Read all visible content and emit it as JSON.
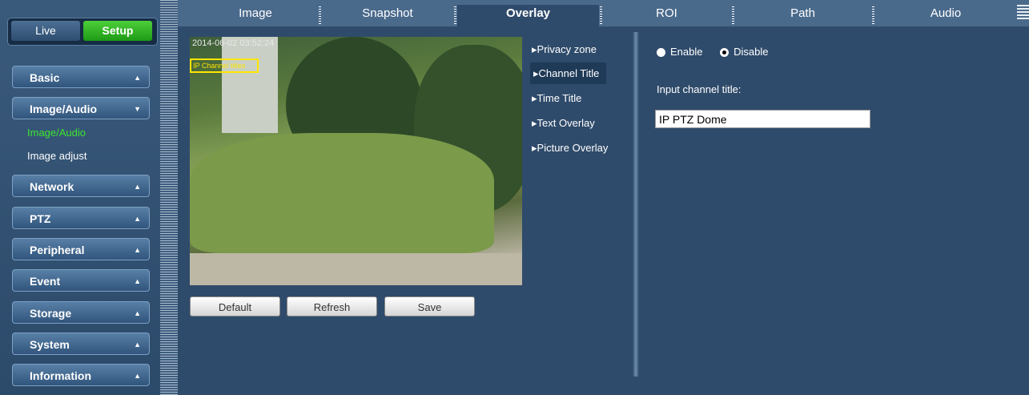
{
  "sidebar": {
    "live_label": "Live",
    "setup_label": "Setup",
    "nav": [
      {
        "label": "Basic",
        "arrow": "▲"
      },
      {
        "label": "Image/Audio",
        "arrow": "▼"
      },
      {
        "label": "Network",
        "arrow": "▲"
      },
      {
        "label": "PTZ",
        "arrow": "▲"
      },
      {
        "label": "Peripheral",
        "arrow": "▲"
      },
      {
        "label": "Event",
        "arrow": "▲"
      },
      {
        "label": "Storage",
        "arrow": "▲"
      },
      {
        "label": "System",
        "arrow": "▲"
      },
      {
        "label": "Information",
        "arrow": "▲"
      }
    ],
    "sub_items": [
      {
        "label": "Image/Audio",
        "color": "#3ee62e"
      },
      {
        "label": "Image adjust",
        "color": "#ffffff"
      }
    ]
  },
  "tabs": [
    "Image",
    "Snapshot",
    "Overlay",
    "ROI",
    "Path",
    "Audio"
  ],
  "active_tab": "Overlay",
  "preview": {
    "timestamp": "2014-06-02 03:52:24",
    "title_overlay": "IP Channel titles"
  },
  "buttons": {
    "default_label": "Default",
    "refresh_label": "Refresh",
    "save_label": "Save"
  },
  "submenu": [
    "▸Privacy zone",
    "▸Channel Title",
    "▸Time Title",
    "▸Text Overlay",
    "▸Picture Overlay"
  ],
  "active_submenu": "▸Channel Title",
  "settings": {
    "enable_label": "Enable",
    "disable_label": "Disable",
    "selected": "Disable",
    "input_label": "Input channel title:",
    "channel_title_value": "IP PTZ Dome"
  }
}
